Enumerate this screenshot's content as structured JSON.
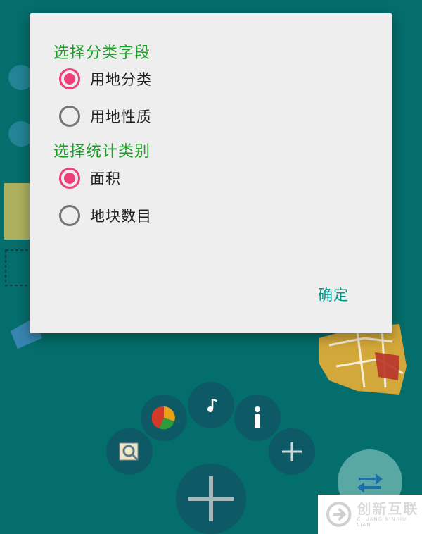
{
  "dialog": {
    "section1_title": "选择分类字段",
    "section1_options": [
      {
        "label": "用地分类",
        "checked": true
      },
      {
        "label": "用地性质",
        "checked": false
      }
    ],
    "section2_title": "选择统计类别",
    "section2_options": [
      {
        "label": "面积",
        "checked": true
      },
      {
        "label": "地块数目",
        "checked": false
      }
    ],
    "ok_label": "确定"
  },
  "toolbar": {
    "buttons": [
      "map-search-icon",
      "pie-chart-icon",
      "music-note-icon",
      "info-icon",
      "plus-icon",
      "large-plus-icon",
      "swap-arrows-icon"
    ]
  },
  "watermark": {
    "cn": "创新互联",
    "en": "CHUANG XIN HU LIAN"
  },
  "colors": {
    "background": "#046e6c",
    "accent_title": "#1f9e2a",
    "radio_checked": "#ef3f78",
    "ok_button": "#009688"
  }
}
